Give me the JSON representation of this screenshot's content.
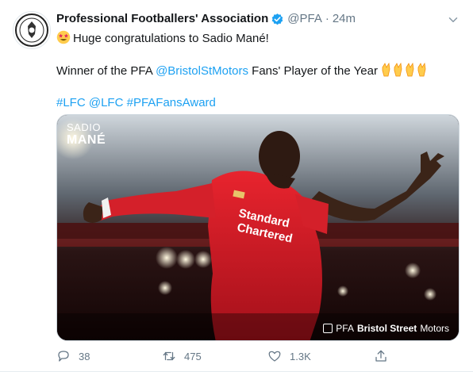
{
  "tweet": {
    "author_name": "Professional Footballers' Association",
    "handle": "@PFA",
    "separator": "·",
    "time": "24m",
    "line1_text": "Huge congratulations to Sadio Mané!",
    "line2_prefix": "Winner of the PFA ",
    "line2_mention": "@BristolStMotors",
    "line2_suffix": " Fans' Player of the Year ",
    "hashtag1": "#LFC",
    "mention2": "@LFC",
    "hashtag2": "#PFAFansAward"
  },
  "media": {
    "first_name": "SADIO",
    "last_name": "MANÉ",
    "sponsor_prefix": "PFA",
    "sponsor_name": "Bristol Street",
    "sponsor_suffix": "Motors"
  },
  "actions": {
    "replies": "38",
    "retweets": "475",
    "likes": "1.3K"
  },
  "colors": {
    "link": "#1da1f2",
    "verified": "#1da1f2",
    "muted": "#657786"
  },
  "icons": [
    "pfa-logo-icon",
    "verified-badge-icon",
    "chevron-down-icon",
    "star-struck-emoji-icon",
    "clapping-hands-emoji-icon",
    "reply-icon",
    "retweet-icon",
    "like-icon",
    "share-icon"
  ]
}
